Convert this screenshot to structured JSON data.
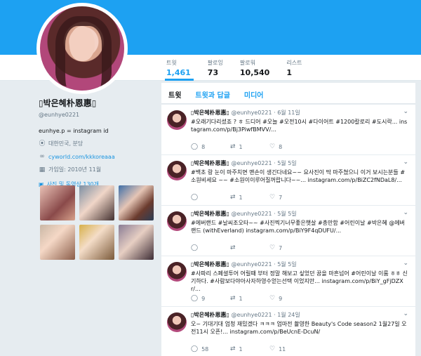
{
  "profile": {
    "name": "▯박은혜朴恩惠▯",
    "handle": "@eunhye0221",
    "bio": "eunhye.p = instagram id",
    "location": "대한민국, 분당",
    "website": "cyworld.com/kkkoreaaa",
    "joined": "가입일: 2010년 11월",
    "media_link": "사진 및 동영상 130개"
  },
  "stats": [
    {
      "label": "트윗",
      "value": "1,461"
    },
    {
      "label": "팔로잉",
      "value": "73"
    },
    {
      "label": "팔로워",
      "value": "10,540"
    },
    {
      "label": "리스트",
      "value": "1"
    }
  ],
  "tabs": [
    "트윗",
    "트윗과 답글",
    "미디어"
  ],
  "colors": {
    "accent": "#1da1f2",
    "link": "#1b95e0",
    "muted": "#657786",
    "background": "#e6ecf0"
  },
  "tweets": [
    {
      "name": "▯박은혜朴恩惠▯",
      "meta": "@eunhye0221 · 6월 11일",
      "text": "#오래기다리셨죠 ? ㅎ 드디어 #오늘 #오전10시 #다이어트 #1200칼로리 #도시락... instagram.com/p/Bj3PiwfBMVV/...",
      "reply": "8",
      "retweet": "1",
      "like": "8"
    },
    {
      "name": "▯박은혜朴恩惠▯",
      "meta": "@eunhye0221 · 5월 5일",
      "text": "#백초 랑 눈이 마주치면 맨손이 생긴다네요~~ 요사진이 딱 마주쳤으니 이거 보시는분들 #소원비세요 ~~ #소원이이루어질꺼랍니다~~... instagram.com/p/BiZC2fNDaL8/...",
      "reply": "",
      "retweet": "1",
      "like": "7"
    },
    {
      "name": "▯박은혜朴恩惠▯",
      "meta": "@eunhye0221 · 5월 5일",
      "text": "#에버랜드 #날씨조오타~~ #사진찍기너무좋은햇살 #총만함 #어린이날 #박은혜 @에버랜드 (withEverland) instagram.com/p/BiY9F4qDUFU/...",
      "reply": "",
      "retweet": "",
      "like": "7"
    },
    {
      "name": "▯박은혜朴恩惠▯",
      "meta": "@eunhye0221 · 5월 5일",
      "text": "#사파리 스페셜투어 어릴때 부터 정말 해보고 싶었던 꿈을 마흔넘어 #어린이날 이룸 ㅎㅎ 신기하다. #사람보다야아사자하영수얻는선택 이었지만... instagram.com/p/BiY_gFjDZXr/...",
      "reply": "9",
      "retweet": "1",
      "like": "9"
    },
    {
      "name": "▯박은혜朴恩惠▯",
      "meta": "@eunhye0221 · 1월 24일",
      "text": "오~ 기대기대 엄청 재밌겠다 ㅋㅋㅋ 엄마전 촬영한 Beauty's Code season2 1월27일 오전11시 오픈!... instagram.com/p/BeUcnE-DcuN/",
      "reply": "58",
      "retweet": "1",
      "like": "11"
    }
  ]
}
